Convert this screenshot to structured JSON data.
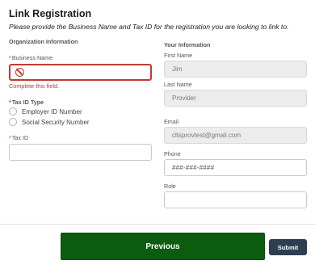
{
  "page": {
    "title": "Link Registration",
    "subtitle": "Please provide the Business Name and Tax ID for the registration you are looking to link to."
  },
  "organization": {
    "section_title": "Organization Information",
    "business_name": {
      "label": "Business Name",
      "required_mark": "*",
      "value": "",
      "error": "Complete this field."
    },
    "tax_id_type": {
      "label": "Tax ID Type",
      "required_mark": "*",
      "options": [
        "Employer ID Number",
        "Social Security Number"
      ]
    },
    "tax_id": {
      "label": "Tax ID",
      "required_mark": "*",
      "value": ""
    }
  },
  "your_information": {
    "section_title": "Your Information",
    "first_name": {
      "label": "First Name",
      "value": "Jim"
    },
    "last_name": {
      "label": "Last Name",
      "value": "Provider"
    },
    "email": {
      "label": "Email",
      "value": "cltsprovtest@gmail.com"
    },
    "phone": {
      "label": "Phone",
      "placeholder": "###-###-####"
    },
    "role": {
      "label": "Role",
      "value": ""
    }
  },
  "actions": {
    "previous_label": "Previous",
    "submit_label": "Submit"
  },
  "colors": {
    "error": "#c23934",
    "previous_button": "#0b5c0f",
    "submit_button": "#2d3e50"
  },
  "icons": {
    "error": "ban-icon"
  }
}
